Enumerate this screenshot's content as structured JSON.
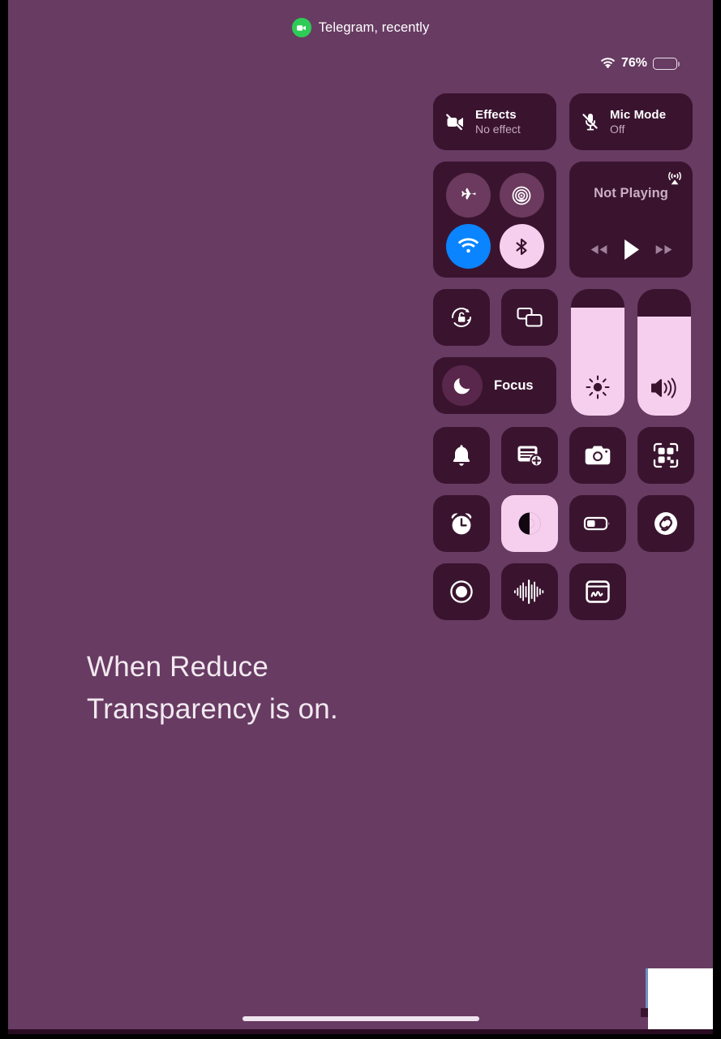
{
  "status_bar": {
    "recent_app": {
      "label": "Telegram, recently",
      "icon": "video-camera-icon",
      "dot_color": "#2ECC56"
    },
    "wifi_icon": "wifi-icon",
    "battery_percent": "76%",
    "battery_level": 76
  },
  "control_center": {
    "effects": {
      "title": "Effects",
      "subtitle": "No effect",
      "icon": "video-camera-slash-icon",
      "active": false
    },
    "mic_mode": {
      "title": "Mic Mode",
      "subtitle": "Off",
      "icon": "microphone-slash-icon",
      "active": false
    },
    "connectivity": [
      {
        "name": "airplane-mode",
        "icon": "airplane-icon",
        "active": false
      },
      {
        "name": "airdrop",
        "icon": "airdrop-icon",
        "active": false
      },
      {
        "name": "wifi",
        "icon": "wifi-icon",
        "active": true,
        "color": "#0A84FF"
      },
      {
        "name": "bluetooth",
        "icon": "bluetooth-icon",
        "active": true,
        "color": "#F6CFEE"
      }
    ],
    "media": {
      "title": "Not Playing",
      "airplay_icon": "airplay-icon",
      "controls": [
        {
          "name": "rewind",
          "icon": "rewind-icon"
        },
        {
          "name": "play",
          "icon": "play-icon"
        },
        {
          "name": "forward",
          "icon": "fast-forward-icon"
        }
      ]
    },
    "rotation_lock": {
      "label": "Rotation Lock",
      "icon": "rotation-lock-icon",
      "active": false
    },
    "screen_mirroring": {
      "label": "Screen Mirroring",
      "icon": "screen-mirroring-icon",
      "active": false
    },
    "focus": {
      "label": "Focus",
      "icon": "crescent-moon-icon",
      "active": false
    },
    "brightness": {
      "label": "Brightness",
      "icon": "brightness-icon",
      "value": 85
    },
    "volume": {
      "label": "Volume",
      "icon": "speaker-icon",
      "value": 78
    },
    "buttons": [
      {
        "name": "ringer",
        "label": "Ringer",
        "icon": "bell-icon",
        "active": false
      },
      {
        "name": "notes",
        "label": "Notes",
        "icon": "note-add-icon",
        "active": false
      },
      {
        "name": "camera",
        "label": "Camera",
        "icon": "camera-icon",
        "active": false
      },
      {
        "name": "code-scanner",
        "label": "Code Scanner",
        "icon": "qr-code-icon",
        "active": false
      },
      {
        "name": "alarm",
        "label": "Alarm",
        "icon": "alarm-clock-icon",
        "active": false
      },
      {
        "name": "dark-mode",
        "label": "Dark Mode",
        "icon": "dark-mode-icon",
        "active": true
      },
      {
        "name": "low-power-mode",
        "label": "Low Power Mode",
        "icon": "battery-icon",
        "active": false
      },
      {
        "name": "shazam",
        "label": "Shazam",
        "icon": "shazam-icon",
        "active": false
      },
      {
        "name": "screen-recording",
        "label": "Screen Recording",
        "icon": "record-icon",
        "active": false
      },
      {
        "name": "voice-memos",
        "label": "Voice Memos",
        "icon": "waveform-icon",
        "active": false
      },
      {
        "name": "quick-note",
        "label": "Quick Note",
        "icon": "quick-note-icon",
        "active": false
      }
    ]
  },
  "caption": {
    "line1": "When Reduce",
    "line2": "Transparency is on."
  },
  "colors": {
    "wallpaper": "#683B63",
    "tile": "#3A142F",
    "tile_active": "#F6CFEE",
    "wifi_blue": "#0A84FF",
    "green": "#2ECC56"
  }
}
